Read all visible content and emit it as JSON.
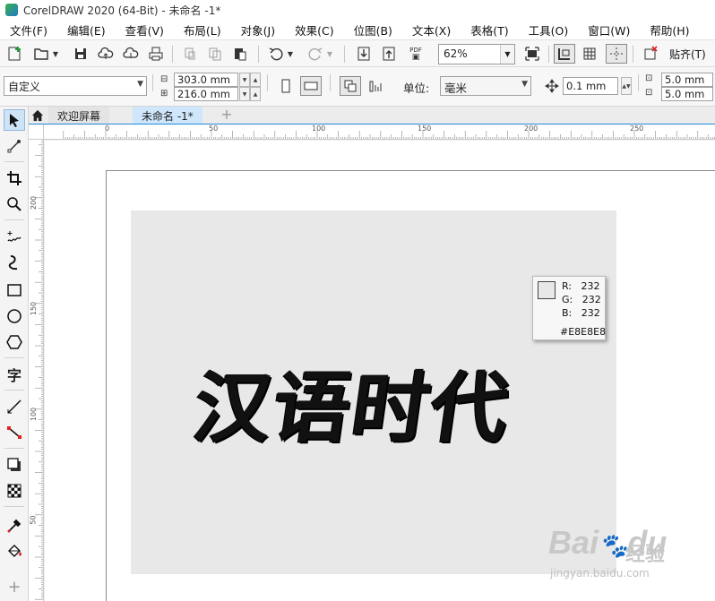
{
  "window": {
    "title": "CorelDRAW 2020 (64-Bit) - 未命名 -1*"
  },
  "menu": [
    {
      "label": "文件(F)",
      "name": "menu-file"
    },
    {
      "label": "编辑(E)",
      "name": "menu-edit"
    },
    {
      "label": "查看(V)",
      "name": "menu-view"
    },
    {
      "label": "布局(L)",
      "name": "menu-layout"
    },
    {
      "label": "对象(J)",
      "name": "menu-object"
    },
    {
      "label": "效果(C)",
      "name": "menu-effects"
    },
    {
      "label": "位图(B)",
      "name": "menu-bitmaps"
    },
    {
      "label": "文本(X)",
      "name": "menu-text"
    },
    {
      "label": "表格(T)",
      "name": "menu-table"
    },
    {
      "label": "工具(O)",
      "name": "menu-tools"
    },
    {
      "label": "窗口(W)",
      "name": "menu-window"
    },
    {
      "label": "帮助(H)",
      "name": "menu-help"
    }
  ],
  "standard_toolbar": {
    "zoom": "62%",
    "paste_label": "贴齐(T)",
    "pdf_label": "PDF"
  },
  "property_bar": {
    "page_preset": "自定义",
    "width": "303.0 mm",
    "height": "216.0 mm",
    "units_label": "单位:",
    "units": "毫米",
    "nudge": "0.1 mm",
    "duplicate_x": "5.0 mm",
    "duplicate_y": "5.0 mm"
  },
  "tabs": {
    "welcome": "欢迎屏幕",
    "document": "未命名 -1*",
    "add": "+"
  },
  "rulers": {
    "horizontal_labels": [
      "0",
      "50",
      "100",
      "150",
      "200",
      "250"
    ],
    "vertical_labels": [
      "200",
      "150",
      "100",
      "50"
    ]
  },
  "artwork": {
    "text": "汉语时代",
    "background_color": "#E8E8E8"
  },
  "color_picker": {
    "r": "R:   232",
    "g": "G:   232",
    "b": "B:   232",
    "hex": "#E8E8E8",
    "swatch_color": "#E8E8E8"
  },
  "watermark": {
    "brand": "Bai",
    "brand_suffix": "du",
    "chinese": "经验",
    "url": "jingyan.baidu.com"
  }
}
